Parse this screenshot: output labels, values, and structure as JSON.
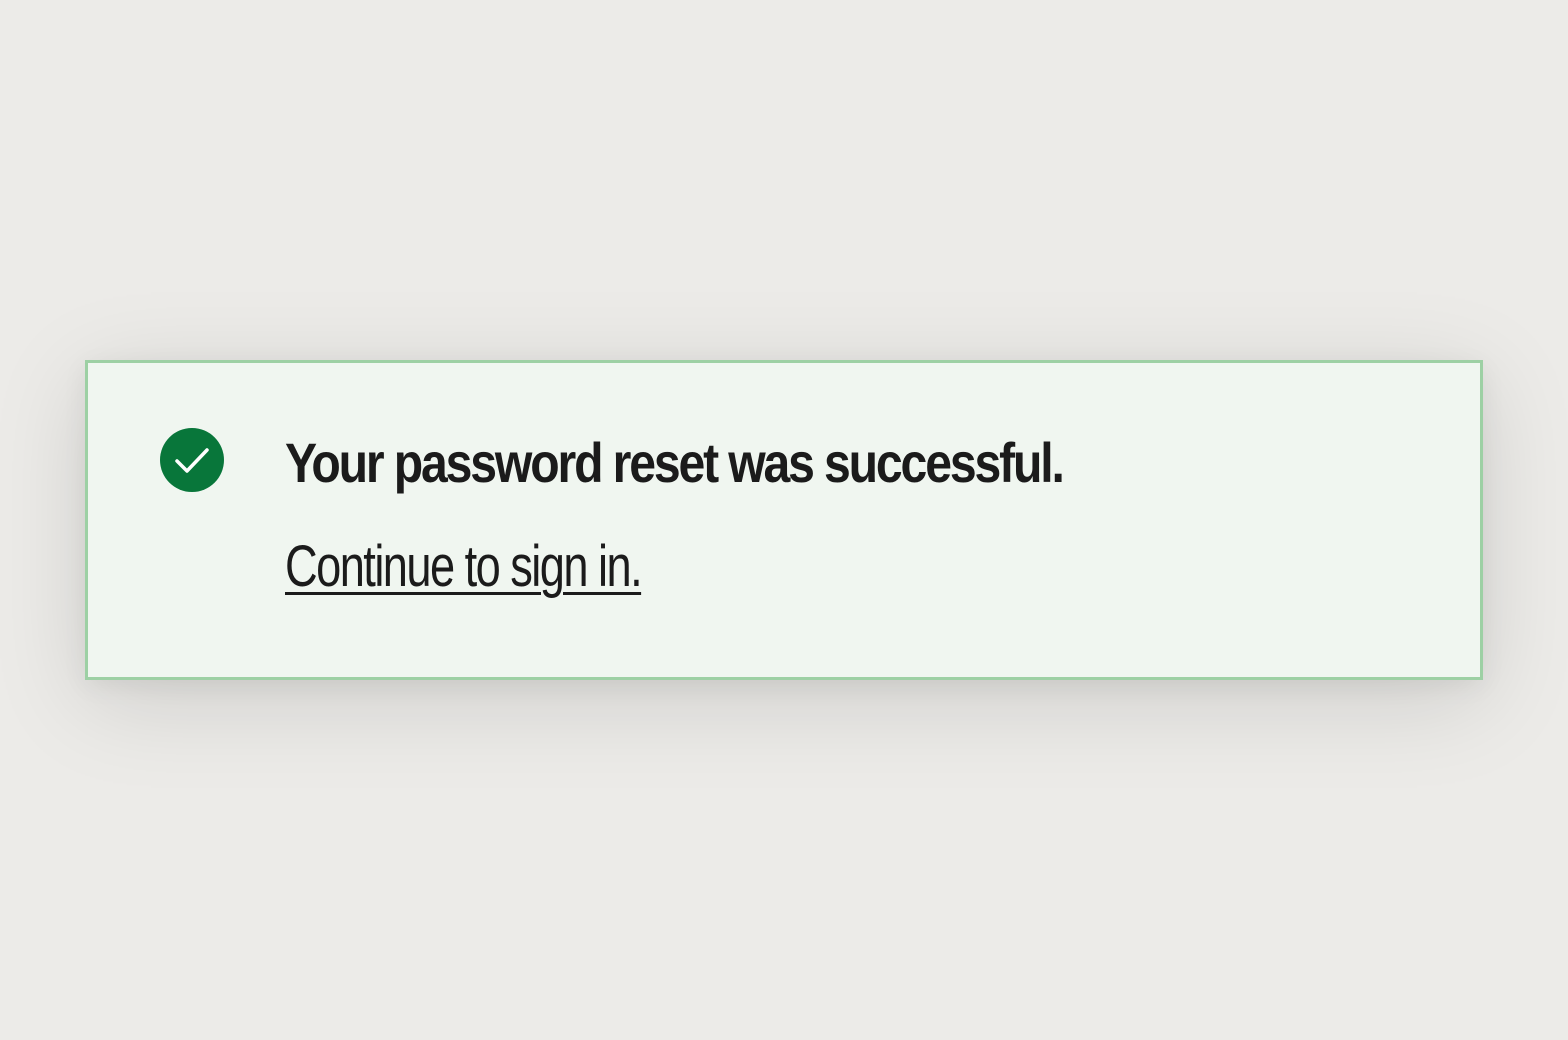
{
  "alert": {
    "type": "success",
    "icon": "check-circle-icon",
    "title": "Your password reset was successful.",
    "link_text": "Continue to sign in.",
    "colors": {
      "background": "#f0f6f0",
      "border": "#9dd0a4",
      "icon": "#08763a",
      "text": "#1b1b1b",
      "page_background": "#ecebe8"
    }
  }
}
